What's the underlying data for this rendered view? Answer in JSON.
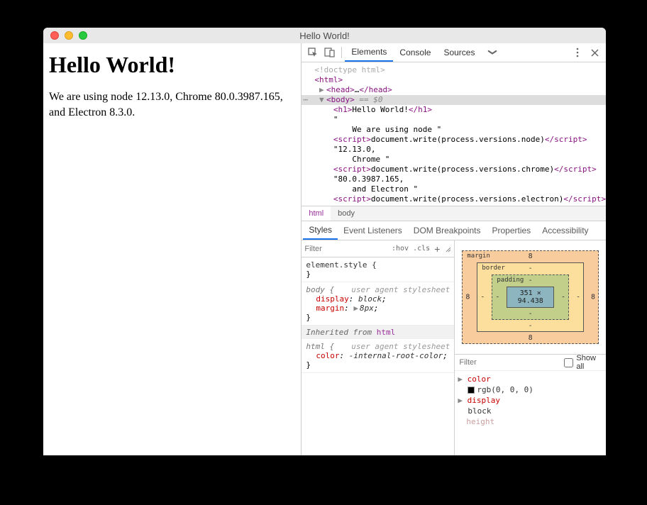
{
  "window": {
    "title": "Hello World!"
  },
  "page": {
    "heading": "Hello World!",
    "paragraph": "We are using node 12.13.0, Chrome 80.0.3987.165, and Electron 8.3.0."
  },
  "devtools": {
    "tabs": {
      "elements": "Elements",
      "console": "Console",
      "sources": "Sources"
    },
    "dom": {
      "doctype": "<!doctype html>",
      "html_open": "<html>",
      "head": {
        "open": "<head>",
        "ell": "…",
        "close": "</head>"
      },
      "body_open": "<body>",
      "eqvar": " == $0",
      "h1": {
        "open": "<h1>",
        "text": "Hello World!",
        "close": "</h1>"
      },
      "t_quote": "\"",
      "t_using_node": "    We are using node \"",
      "script1": {
        "open": "<script>",
        "code": "document.write(process.versions.node)",
        "close": "</script>"
      },
      "t_node_ver": "\"12.13.0,",
      "t_chrome": "    Chrome \"",
      "script2": {
        "open": "<script>",
        "code": "document.write(process.versions.chrome)",
        "close": "</script>"
      },
      "t_chrome_ver": "\"80.0.3987.165,",
      "t_electron": "    and Electron \"",
      "script3": {
        "open": "<script>",
        "code": "document.write(process.versions.electron)",
        "close": "</script>"
      }
    },
    "crumbs": {
      "html": "html",
      "body": "body"
    },
    "styles_tabs": {
      "styles": "Styles",
      "listeners": "Event Listeners",
      "dom_bp": "DOM Breakpoints",
      "props": "Properties",
      "a11y": "Accessibility"
    },
    "filter": {
      "placeholder": "Filter",
      "hov": ":hov",
      "cls": ".cls"
    },
    "rules": {
      "elstyle": "element.style {",
      "body_sel": "body {",
      "ua_label": "user agent stylesheet",
      "display": {
        "name": "display",
        "value": "block"
      },
      "margin": {
        "name": "margin",
        "value": "8px"
      },
      "close": "}",
      "inherited": "Inherited from ",
      "inherited_link": "html",
      "html_sel": "html {",
      "color": {
        "name": "color",
        "value": "-internal-root-color"
      }
    },
    "boxmodel": {
      "margin_label": "margin",
      "border_label": "border",
      "padding_label": "padding",
      "margin_vals": {
        "t": "8",
        "r": "8",
        "b": "8",
        "l": "8"
      },
      "border_vals": {
        "t": "-",
        "r": "-",
        "b": "-",
        "l": "-"
      },
      "padding_vals": {
        "t": "-",
        "r": "-",
        "b": "-",
        "l": "-"
      },
      "content": "351 × 94.438"
    },
    "computed_filter": {
      "placeholder": "Filter",
      "showall": "Show all"
    },
    "computed": {
      "color": {
        "key": "color",
        "val": "rgb(0, 0, 0)"
      },
      "display": {
        "key": "display",
        "val": "block"
      },
      "height": {
        "key": "height"
      }
    }
  }
}
